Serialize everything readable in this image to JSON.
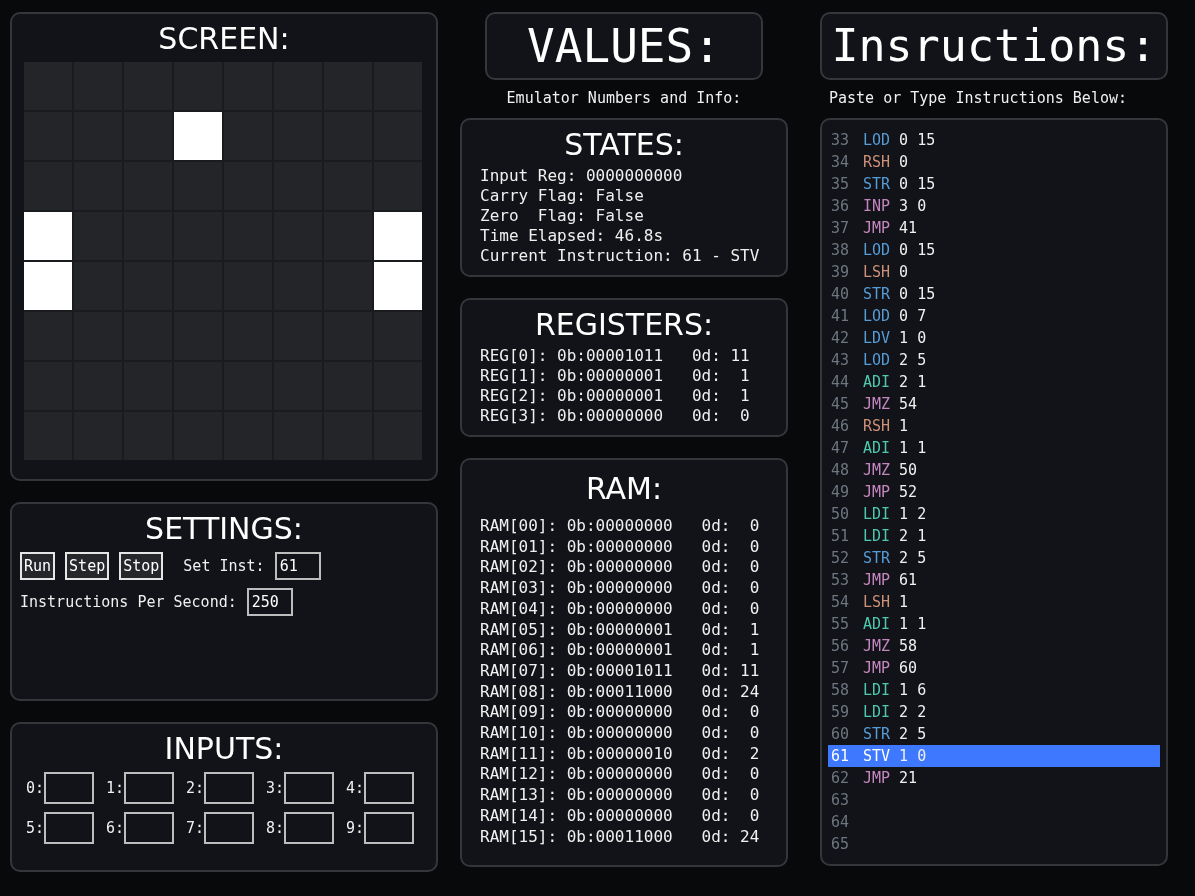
{
  "screen": {
    "title": "SCREEN:",
    "rows": [
      [
        {
          "on": false
        },
        {
          "on": false
        },
        {
          "on": false
        },
        {
          "on": false
        },
        {
          "on": false
        },
        {
          "on": false
        },
        {
          "on": false
        },
        {
          "on": false
        }
      ],
      [
        {
          "on": false
        },
        {
          "on": false
        },
        {
          "on": false
        },
        {
          "on": true
        },
        {
          "on": false
        },
        {
          "on": false
        },
        {
          "on": false
        },
        {
          "on": false
        }
      ],
      [
        {
          "on": false
        },
        {
          "on": false
        },
        {
          "on": false
        },
        {
          "on": false
        },
        {
          "on": false
        },
        {
          "on": false
        },
        {
          "on": false
        },
        {
          "on": false
        }
      ],
      [
        {
          "on": true
        },
        {
          "on": false
        },
        {
          "on": false
        },
        {
          "on": false
        },
        {
          "on": false
        },
        {
          "on": false
        },
        {
          "on": false
        },
        {
          "on": true
        }
      ],
      [
        {
          "on": true
        },
        {
          "on": false
        },
        {
          "on": false
        },
        {
          "on": false
        },
        {
          "on": false
        },
        {
          "on": false
        },
        {
          "on": false
        },
        {
          "on": true
        }
      ],
      [
        {
          "on": false
        },
        {
          "on": false
        },
        {
          "on": false
        },
        {
          "on": false
        },
        {
          "on": false
        },
        {
          "on": false
        },
        {
          "on": false
        },
        {
          "on": false
        }
      ],
      [
        {
          "on": false
        },
        {
          "on": false
        },
        {
          "on": false
        },
        {
          "on": false
        },
        {
          "on": false
        },
        {
          "on": false
        },
        {
          "on": false
        },
        {
          "on": false
        }
      ],
      [
        {
          "on": false
        },
        {
          "on": false
        },
        {
          "on": false
        },
        {
          "on": false
        },
        {
          "on": false
        },
        {
          "on": false
        },
        {
          "on": false
        },
        {
          "on": false
        }
      ]
    ]
  },
  "settings": {
    "title": "SETTINGS:",
    "buttons": [
      "Run",
      "Step",
      "Stop"
    ],
    "set_inst": {
      "label": "Set Inst:",
      "value": "61"
    },
    "speed": {
      "label": "Instructions Per Second:",
      "value": "250"
    }
  },
  "inputs": {
    "title": "INPUTS:",
    "fields": [
      {
        "label": "0:"
      },
      {
        "label": "1:"
      },
      {
        "label": "2:"
      },
      {
        "label": "3:"
      },
      {
        "label": "4:"
      },
      {
        "label": "5:"
      },
      {
        "label": "6:"
      },
      {
        "label": "7:"
      },
      {
        "label": "8:"
      },
      {
        "label": "9:"
      }
    ]
  },
  "values": {
    "title": "VALUES:",
    "subtitle": "Emulator Numbers and Info:"
  },
  "states": {
    "title": "STATES:",
    "lines": [
      "Input Reg: 0000000000",
      "Carry Flag: False",
      "Zero  Flag: False",
      "Time Elapsed: 46.8s",
      "Current Instruction: 61 - STV"
    ]
  },
  "registers": {
    "title": "REGISTERS:",
    "lines": [
      "REG[0]: 0b:00001011   0d: 11",
      "REG[1]: 0b:00000001   0d:  1",
      "REG[2]: 0b:00000001   0d:  1",
      "REG[3]: 0b:00000000   0d:  0"
    ]
  },
  "ram": {
    "title": "RAM:",
    "lines": [
      "RAM[00]: 0b:00000000   0d:  0",
      "RAM[01]: 0b:00000000   0d:  0",
      "RAM[02]: 0b:00000000   0d:  0",
      "RAM[03]: 0b:00000000   0d:  0",
      "RAM[04]: 0b:00000000   0d:  0",
      "RAM[05]: 0b:00000001   0d:  1",
      "RAM[06]: 0b:00000001   0d:  1",
      "RAM[07]: 0b:00001011   0d: 11",
      "RAM[08]: 0b:00011000   0d: 24",
      "RAM[09]: 0b:00000000   0d:  0",
      "RAM[10]: 0b:00000000   0d:  0",
      "RAM[11]: 0b:00000010   0d:  2",
      "RAM[12]: 0b:00000000   0d:  0",
      "RAM[13]: 0b:00000000   0d:  0",
      "RAM[14]: 0b:00000000   0d:  0",
      "RAM[15]: 0b:00011000   0d: 24"
    ]
  },
  "instructions": {
    "title": "Insructions:",
    "subtitle": "Paste or Type Instructions Below:",
    "lines": [
      {
        "number": "33",
        "op": "LOD",
        "args": "0 15",
        "color": "#569cd6",
        "selected": false
      },
      {
        "number": "34",
        "op": "RSH",
        "args": "0",
        "color": "#ce9178",
        "selected": false
      },
      {
        "number": "35",
        "op": "STR",
        "args": "0 15",
        "color": "#569cd6",
        "selected": false
      },
      {
        "number": "36",
        "op": "INP",
        "args": "3 0",
        "color": "#c586c0",
        "selected": false
      },
      {
        "number": "37",
        "op": "JMP",
        "args": "41",
        "color": "#c586c0",
        "selected": false
      },
      {
        "number": "38",
        "op": "LOD",
        "args": "0 15",
        "color": "#569cd6",
        "selected": false
      },
      {
        "number": "39",
        "op": "LSH",
        "args": "0",
        "color": "#ce9178",
        "selected": false
      },
      {
        "number": "40",
        "op": "STR",
        "args": "0 15",
        "color": "#569cd6",
        "selected": false
      },
      {
        "number": "41",
        "op": "LOD",
        "args": "0 7",
        "color": "#569cd6",
        "selected": false
      },
      {
        "number": "42",
        "op": "LDV",
        "args": "1 0",
        "color": "#569cd6",
        "selected": false
      },
      {
        "number": "43",
        "op": "LOD",
        "args": "2 5",
        "color": "#569cd6",
        "selected": false
      },
      {
        "number": "44",
        "op": "ADI",
        "args": "2 1",
        "color": "#4ec9b0",
        "selected": false
      },
      {
        "number": "45",
        "op": "JMZ",
        "args": "54",
        "color": "#c586c0",
        "selected": false
      },
      {
        "number": "46",
        "op": "RSH",
        "args": "1",
        "color": "#ce9178",
        "selected": false
      },
      {
        "number": "47",
        "op": "ADI",
        "args": "1 1",
        "color": "#4ec9b0",
        "selected": false
      },
      {
        "number": "48",
        "op": "JMZ",
        "args": "50",
        "color": "#c586c0",
        "selected": false
      },
      {
        "number": "49",
        "op": "JMP",
        "args": "52",
        "color": "#c586c0",
        "selected": false
      },
      {
        "number": "50",
        "op": "LDI",
        "args": "1 2",
        "color": "#4ec9b0",
        "selected": false
      },
      {
        "number": "51",
        "op": "LDI",
        "args": "2 1",
        "color": "#4ec9b0",
        "selected": false
      },
      {
        "number": "52",
        "op": "STR",
        "args": "2 5",
        "color": "#569cd6",
        "selected": false
      },
      {
        "number": "53",
        "op": "JMP",
        "args": "61",
        "color": "#c586c0",
        "selected": false
      },
      {
        "number": "54",
        "op": "LSH",
        "args": "1",
        "color": "#ce9178",
        "selected": false
      },
      {
        "number": "55",
        "op": "ADI",
        "args": "1 1",
        "color": "#4ec9b0",
        "selected": false
      },
      {
        "number": "56",
        "op": "JMZ",
        "args": "58",
        "color": "#c586c0",
        "selected": false
      },
      {
        "number": "57",
        "op": "JMP",
        "args": "60",
        "color": "#c586c0",
        "selected": false
      },
      {
        "number": "58",
        "op": "LDI",
        "args": "1 6",
        "color": "#4ec9b0",
        "selected": false
      },
      {
        "number": "59",
        "op": "LDI",
        "args": "2 2",
        "color": "#4ec9b0",
        "selected": false
      },
      {
        "number": "60",
        "op": "STR",
        "args": "2 5",
        "color": "#569cd6",
        "selected": false
      },
      {
        "number": "61",
        "op": "STV",
        "args": "1 0",
        "selected": true
      },
      {
        "number": "62",
        "op": "JMP",
        "args": "21",
        "color": "#c586c0",
        "selected": false
      },
      {
        "number": "63",
        "selected": false
      },
      {
        "number": "64",
        "selected": false
      },
      {
        "number": "65",
        "selected": false
      }
    ]
  }
}
